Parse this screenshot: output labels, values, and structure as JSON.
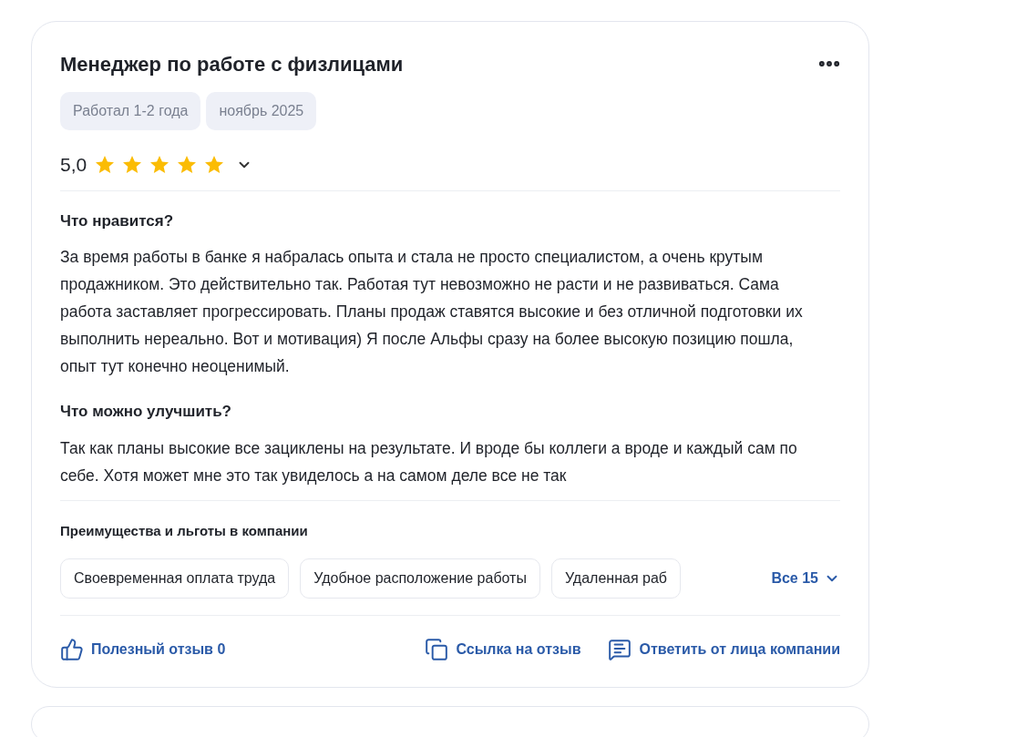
{
  "review": {
    "title": "Менеджер по работе с физлицами",
    "tags": [
      "Работал 1-2 года",
      "ноябрь 2025"
    ],
    "rating": "5,0",
    "stars": 5,
    "sections": [
      {
        "heading": "Что нравится?",
        "text": "За время работы в банке я набралась опыта и стала не просто специалистом, а очень крутым продажником. Это действительно так. Работая тут невозможно не расти и не развиваться. Сама работа заставляет прогрессировать. Планы продаж ставятся высокие и без отличной подготовки их выполнить нереально. Вот и мотивация) Я после Альфы сразу на более высокую позицию пошла, опыт тут конечно неоценимый."
      },
      {
        "heading": "Что можно улучшить?",
        "text": "Так как планы высокие все зациклены на результате. И вроде бы коллеги а вроде и каждый сам по себе. Хотя может мне это так увиделось а на самом деле все не так"
      }
    ],
    "benefits": {
      "heading": "Преимущества и льготы в компании",
      "items": [
        "Своевременная оплата труда",
        "Удобное расположение работы",
        "Удаленная раб"
      ],
      "more": "Все 15"
    },
    "actions": [
      {
        "kind": "like",
        "label": "Полезный отзыв 0"
      },
      {
        "kind": "link",
        "label": "Ссылка на отзыв"
      },
      {
        "kind": "reply",
        "label": "Ответить от лица компании"
      }
    ]
  }
}
